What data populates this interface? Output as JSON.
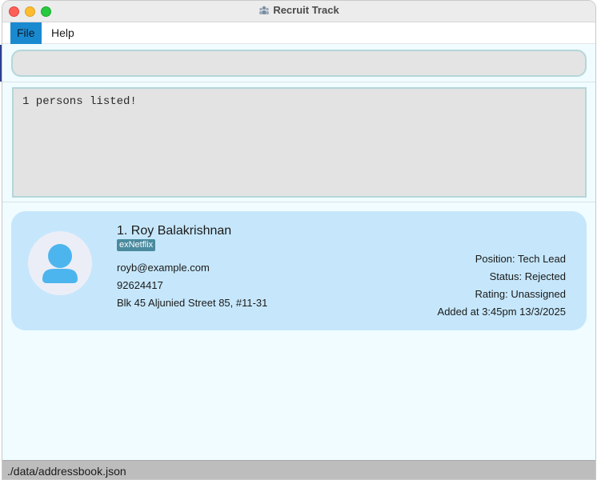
{
  "window": {
    "title": "Recruit Track"
  },
  "menu": {
    "items": [
      {
        "label": "File",
        "active": true
      },
      {
        "label": "Help",
        "active": false
      }
    ]
  },
  "command": {
    "value": "",
    "placeholder": ""
  },
  "result": {
    "message": "1 persons listed!"
  },
  "persons": [
    {
      "index": "1.",
      "name": "Roy Balakrishnan",
      "display_name": "1. Roy Balakrishnan",
      "tags": [
        "exNetflix"
      ],
      "email": "royb@example.com",
      "phone": "92624417",
      "address": "Blk 45 Aljunied Street 85, #11-31",
      "position": "Position:  Tech Lead",
      "status": "Status:  Rejected",
      "rating": "Rating:  Unassigned",
      "added": "Added at 3:45pm 13/3/2025",
      "avatar_icon": "person-avatar-icon"
    }
  ],
  "status_bar": {
    "path": "./data/addressbook.json"
  },
  "colors": {
    "accent": "#1a8ad0",
    "card": "#c6e7fb",
    "tag": "#4a8a9e",
    "background": "#f0fcff"
  }
}
